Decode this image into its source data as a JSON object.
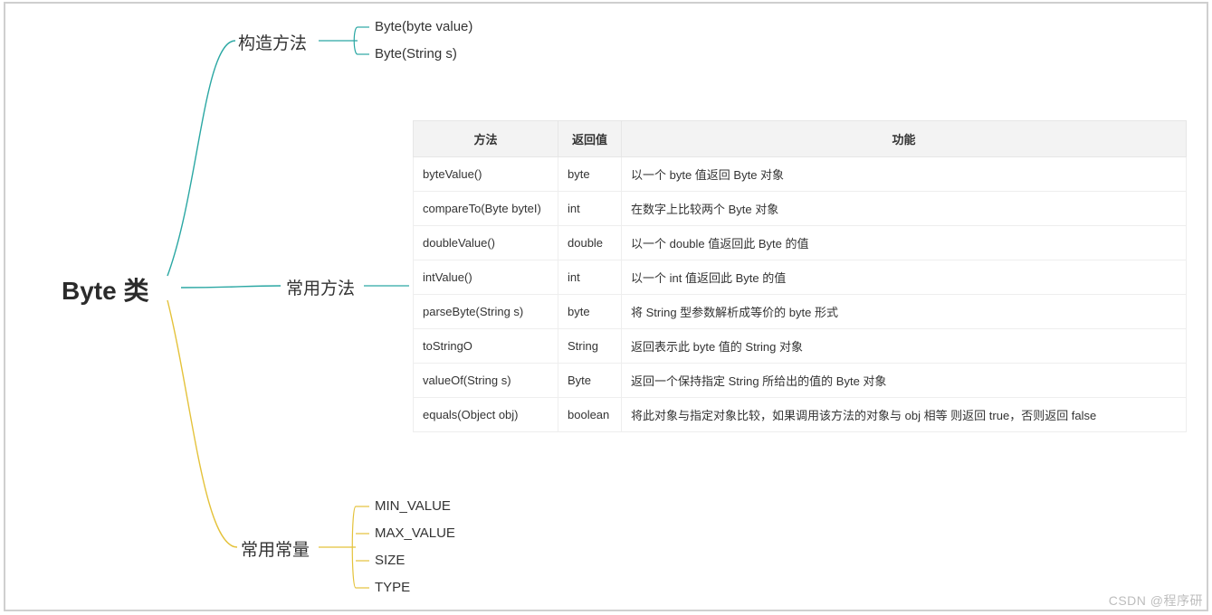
{
  "root": {
    "title": "Byte 类"
  },
  "branches": {
    "constructors": {
      "label": "构造方法",
      "items": [
        "Byte(byte value)",
        "Byte(String s)"
      ]
    },
    "methods": {
      "label": "常用方法",
      "table": {
        "headers": [
          "方法",
          "返回值",
          "功能"
        ],
        "rows": [
          {
            "method": "byteValue()",
            "return": "byte",
            "desc": "以一个 byte 值返回 Byte 对象"
          },
          {
            "method": "compareTo(Byte byteI)",
            "return": "int",
            "desc": "在数字上比较两个 Byte 对象"
          },
          {
            "method": "doubleValue()",
            "return": "double",
            "desc": "以一个 double 值返回此 Byte 的值"
          },
          {
            "method": "intValue()",
            "return": "int",
            "desc": "以一个 int 值返回此 Byte 的值"
          },
          {
            "method": "parseByte(String s)",
            "return": "byte",
            "desc": "将 String 型参数解析成等价的 byte 形式"
          },
          {
            "method": "toStringO",
            "return": "String",
            "desc": "返回表示此 byte 值的 String 对象"
          },
          {
            "method": "valueOf(String s)",
            "return": "Byte",
            "desc": "返回一个保持指定 String 所给出的值的 Byte 对象"
          },
          {
            "method": "equals(Object obj)",
            "return": "boolean",
            "desc": "将此对象与指定对象比较，如果调用该方法的对象与 obj 相等 则返回 true，否则返回 false"
          }
        ]
      }
    },
    "constants": {
      "label": "常用常量",
      "items": [
        "MIN_VALUE",
        "MAX_VALUE",
        "SIZE",
        "TYPE"
      ]
    }
  },
  "watermark": "CSDN @程序研"
}
